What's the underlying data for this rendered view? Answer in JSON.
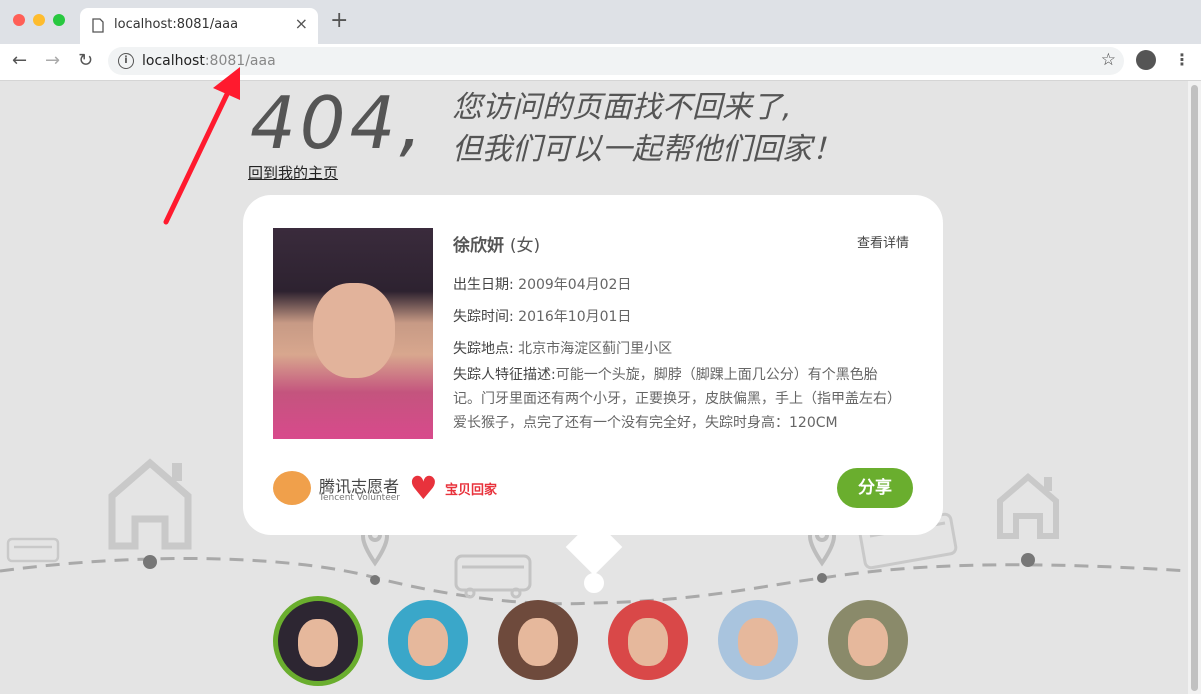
{
  "browser": {
    "tab_title": "localhost:8081/aaa",
    "url_host": "localhost",
    "url_rest": ":8081/aaa",
    "new_tab": "+",
    "close": "×"
  },
  "page": {
    "big_code": "404,",
    "message_line1": "您访问的页面找不回来了,",
    "message_line2": "但我们可以一起帮他们回家！",
    "home_link": "回到我的主页"
  },
  "card": {
    "name": "徐欣妍",
    "gender": "(女)",
    "detail_link": "查看详情",
    "birth_label": "出生日期:",
    "birth_value": "2009年04月02日",
    "missing_time_label": "失踪时间:",
    "missing_time_value": "2016年10月01日",
    "missing_place_label": "失踪地点:",
    "missing_place_value": "北京市海淀区蓟门里小区",
    "features_label": "失踪人特征描述:",
    "features_value": "可能一个头旋，脚脖（脚踝上面几公分）有个黑色胎记。门牙里面还有两个小牙，正要换牙，皮肤偏黑，手上（指甲盖左右）爱长猴子，点完了还有一个没有完全好，失踪时身高：120CM",
    "share_button": "分享",
    "logo_tencent_cn": "腾讯志愿者",
    "logo_tencent_en": "Tencent Volunteer",
    "logo_baobei": "宝贝回家"
  },
  "colors": {
    "accent_green": "#6aae2e",
    "page_bg": "#e4e4e4",
    "arrow_red": "#ff1a2e"
  }
}
